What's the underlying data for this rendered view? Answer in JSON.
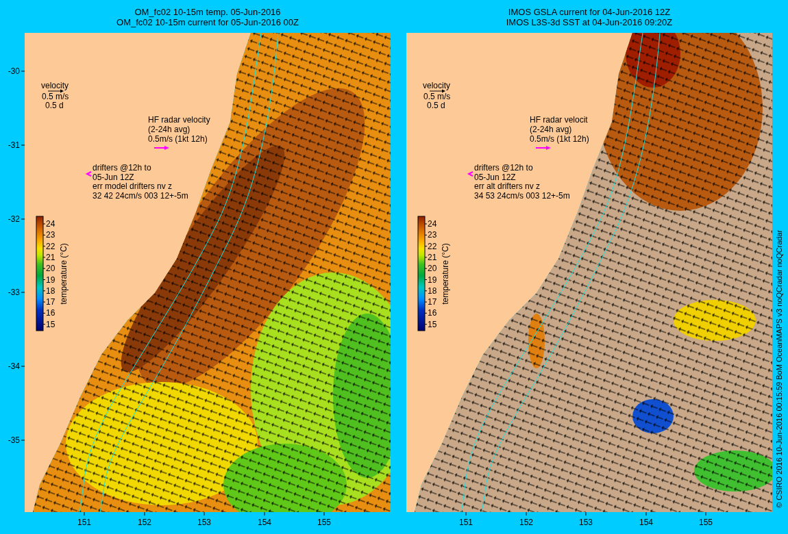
{
  "panels": [
    {
      "kind": "model",
      "title_lines": [
        "OM_fc02 10-15m temp. 05-Jun-2016",
        "OM_fc02 10-15m current for 05-Jun-2016 00Z"
      ],
      "velocity_legend": [
        "velocity",
        "0.5 m/s",
        "0.5 d"
      ],
      "hf_radar_legend": [
        "HF radar velocity",
        "(2-24h avg)",
        "0.5m/s (1kt 12h)"
      ],
      "drifter_legend": [
        "drifters @12h to",
        "05-Jun 12Z",
        "err model drifters nv z",
        "32 42 24cm/s 003 12+-5m"
      ],
      "colorbar": {
        "title": "temperature (°C)",
        "ticks": [
          "24",
          "23",
          "22",
          "21",
          "20",
          "19",
          "18",
          "17",
          "16",
          "15"
        ]
      },
      "x_ticks": [
        "151",
        "152",
        "153",
        "154",
        "155"
      ]
    },
    {
      "kind": "satellite",
      "title_lines": [
        "IMOS GSLA current for 04-Jun-2016 12Z",
        "IMOS L3S-3d SST at 04-Jun-2016 09:20Z"
      ],
      "velocity_legend": [
        "velocity",
        "0.5 m/s",
        "0.5 d"
      ],
      "hf_radar_legend": [
        "HF radar velocit",
        "(2-24h avg)",
        "0.5m/s (1kt 12h)"
      ],
      "drifter_legend": [
        "drifters @12h to",
        "05-Jun 12Z",
        "err alt drifters nv z",
        "34 53 24cm/s 003 12+-5m"
      ],
      "colorbar": {
        "title": "temperature (°C)",
        "ticks": [
          "24",
          "23",
          "22",
          "21",
          "20",
          "19",
          "18",
          "17",
          "16",
          "15"
        ]
      },
      "x_ticks": [
        "151",
        "152",
        "153",
        "154",
        "155"
      ]
    }
  ],
  "y_ticks": [
    "-30",
    "-31",
    "-32",
    "-33",
    "-34",
    "-35"
  ],
  "credit": "© CSIRO 2016   10-Jun-2016 00:15:59 BoM OceanMAPS v3 noQCradar noQCradar"
}
